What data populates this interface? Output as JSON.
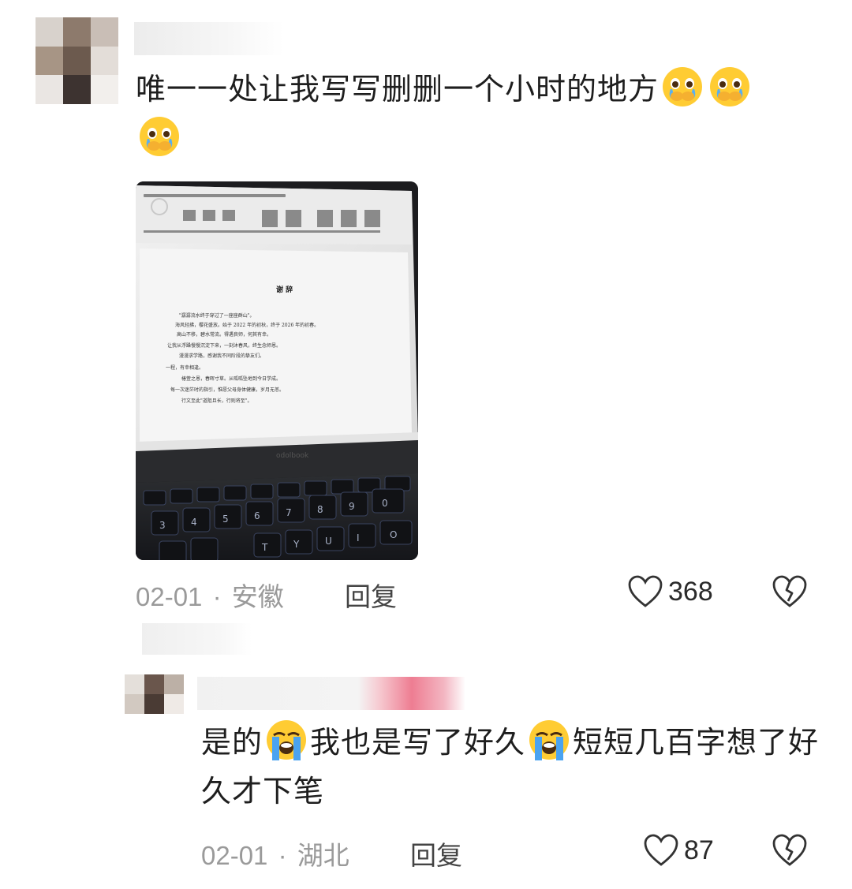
{
  "comments": [
    {
      "text_parts": [
        "唯一一处让我写写删删一个小时的地方"
      ],
      "emoji_count": 3,
      "meta": {
        "date": "02-01",
        "dot": "·",
        "location": "安徽",
        "reply": "回复",
        "likes": "368"
      }
    },
    {
      "text_parts": [
        "是的",
        "我也是写了好久",
        "短短几百字想了好久才下笔"
      ],
      "meta": {
        "date": "02-01",
        "dot": "·",
        "location": "湖北",
        "reply": "回复",
        "likes": "87"
      }
    }
  ],
  "photo": {
    "doc_title": "谢 辞",
    "doc_lines": [
      "\"潺潺流水终于穿过了一座座群山\"。",
      "海风轻拂，樱花盛放。始于 2022 年的初秋，终于 2026 年的初春。",
      "高山不移，碧水常流。得遇良师，何其有幸。",
      "让我从浮躁慢慢沉淀下来，一刻沐春风，终生念师恩。",
      "漫漫求学路，感谢我不同阶段的挚友们。",
      "一程，有幸相逢。",
      "椿萱之恩，春晖寸草。从呱呱坠地到今日学成。",
      "每一次迷茫时的指引，惟愿父母身体健康，岁月无恙。",
      "行文至此\"道阻且长，行则将至\"。"
    ],
    "laptop_brand": "odolbook",
    "keys": [
      "3",
      "4",
      "5",
      "6",
      "7",
      "8",
      "9",
      "0",
      "T",
      "Y",
      "U",
      "I",
      "O"
    ]
  },
  "colors": {
    "text": "#1e1e1e",
    "meta": "#9a9a9a",
    "reply": "#444444"
  }
}
